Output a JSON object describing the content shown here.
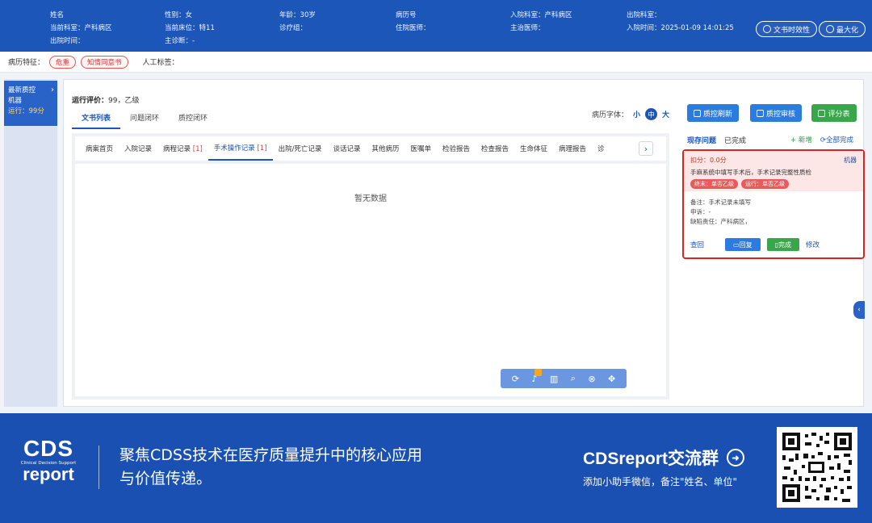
{
  "header": {
    "fields": [
      {
        "label": "姓名",
        "value": ""
      },
      {
        "label": "性别",
        "value": "女"
      },
      {
        "label": "年龄",
        "value": "30岁"
      },
      {
        "label": "病历号",
        "value": ""
      },
      {
        "label": "入院科室",
        "value": "产科病区"
      },
      {
        "label": "出院科室",
        "value": ""
      },
      {
        "label": "当前科室",
        "value": "产科病区"
      },
      {
        "label": "当前床位",
        "value": "特11"
      },
      {
        "label": "诊疗组",
        "value": ""
      },
      {
        "label": "住院医师",
        "value": ""
      },
      {
        "label": "主治医师",
        "value": ""
      },
      {
        "label": "入院时间",
        "value": "2025-01-09 14:01:25"
      },
      {
        "label": "出院时间",
        "value": ""
      },
      {
        "label": "主诊断",
        "value": "-"
      }
    ],
    "btn_timeliness": "文书时效性",
    "btn_maximize": "最大化"
  },
  "feature_bar": {
    "label": "病历特征：",
    "tags": [
      "危重",
      "知情同意书"
    ],
    "manual_label": "人工标签："
  },
  "left_panel": {
    "line1": "最新质控",
    "line2": "机器",
    "line3": "运行：99分"
  },
  "main": {
    "eval_label": "运行评价：",
    "eval_value": "99，乙级",
    "tabs": [
      "文书列表",
      "问题闭环",
      "质控闭环"
    ],
    "font_label": "病历字体：",
    "font_sizes": [
      "小",
      "中",
      "大"
    ],
    "btn_refresh": "质控刷新",
    "btn_review": "质控审核",
    "btn_score": "评分表",
    "colors": {
      "refresh": "#2b7be0",
      "review": "#2b7be0",
      "score": "#3aa64c"
    }
  },
  "doc_tabs": [
    {
      "label": "病案首页",
      "count": ""
    },
    {
      "label": "入院记录",
      "count": ""
    },
    {
      "label": "病程记录",
      "count": "[1]"
    },
    {
      "label": "手术操作记录",
      "count": "[1]"
    },
    {
      "label": "出院/死亡记录",
      "count": ""
    },
    {
      "label": "谈话记录",
      "count": ""
    },
    {
      "label": "其他病历",
      "count": ""
    },
    {
      "label": "医嘱单",
      "count": ""
    },
    {
      "label": "检验报告",
      "count": ""
    },
    {
      "label": "检查报告",
      "count": ""
    },
    {
      "label": "生命体征",
      "count": ""
    },
    {
      "label": "病理报告",
      "count": ""
    },
    {
      "label": "诊",
      "count": ""
    }
  ],
  "doc_body": {
    "empty_text": "暂无数据"
  },
  "right_panel": {
    "tab_current": "现存问题",
    "tab_done": "已完成",
    "add": "+ 新增",
    "complete_all": "全部完成",
    "issue": {
      "deduct": "扣分：0.0分",
      "source": "机器",
      "message": "手麻系统中填写手术后，手术记录完整性质检",
      "tag_final": "终末：单否乙级",
      "tag_running": "运行：单否乙级",
      "remark": "备注：手术记录未填写",
      "appeal": "申诉：-",
      "responsibility": "缺陷责任：产科病区，",
      "act_reject": "查回",
      "act_reply": "回复",
      "act_done": "完成",
      "act_edit": "修改"
    }
  },
  "footer": {
    "logo_big": "CDS",
    "logo_small": "Clinical Decision Support",
    "logo_report": "report",
    "slogan_line1": "聚焦CDSS技术在医疗质量提升中的核心应用",
    "slogan_line2": "与价值传递。",
    "group_title": "CDSreport交流群",
    "group_sub": "添加小助手微信，备注\"姓名、单位\""
  }
}
